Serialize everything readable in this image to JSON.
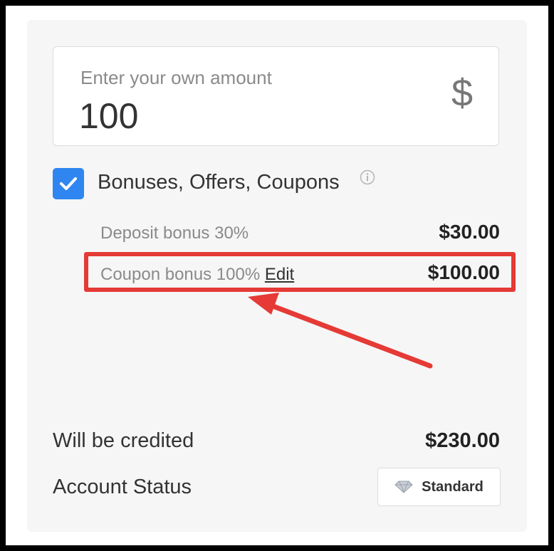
{
  "amount": {
    "label": "Enter your own amount",
    "value": "100",
    "currency_symbol": "$"
  },
  "bonuses": {
    "checked": true,
    "label": "Bonuses, Offers, Coupons",
    "info_icon": "info-icon",
    "items": [
      {
        "label": "Deposit bonus 30%",
        "value": "$30.00"
      },
      {
        "label": "Coupon bonus 100%",
        "link": "Edit",
        "value": "$100.00"
      }
    ]
  },
  "summary": {
    "credited_label": "Will be credited",
    "credited_value": "$230.00",
    "status_label": "Account Status",
    "status_value": "Standard",
    "status_icon": "diamond-icon"
  },
  "colors": {
    "accent": "#2f86f0",
    "highlight": "#e53a35",
    "panel": "#f6f6f6"
  }
}
